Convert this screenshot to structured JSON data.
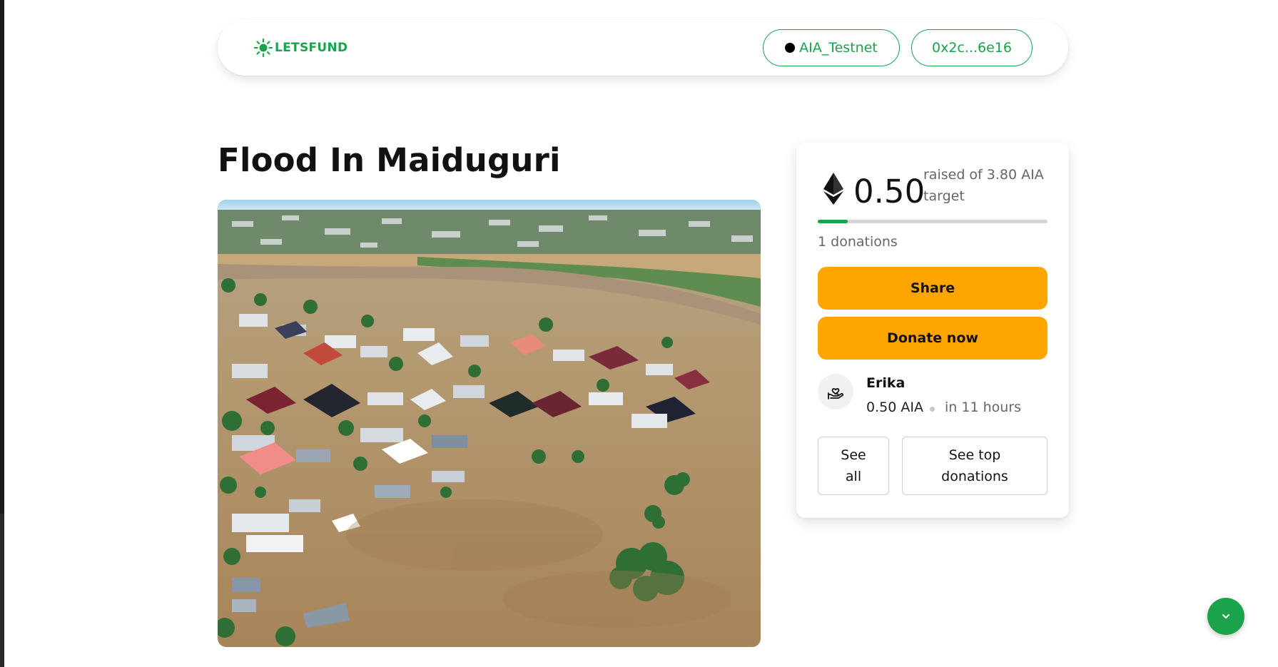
{
  "header": {
    "logo_text": "LETSFUND",
    "network_label": "AIA_Testnet",
    "wallet_address": "0x2c...6e16"
  },
  "campaign": {
    "title": "Flood In Maiduguri",
    "image_alt": "Flood In Maiduguri"
  },
  "funding": {
    "raised_amount": "0.50",
    "raised_caption": "raised of 3.80 AIA target",
    "progress_fraction": 0.13,
    "donations_count_text": "1 donations",
    "share_label": "Share",
    "donate_label": "Donate now"
  },
  "latest_donation": {
    "donor_name": "Erika",
    "amount": "0.50 AIA",
    "time": "in 11 hours"
  },
  "actions": {
    "see_all_label": "See all",
    "see_top_label": "See top donations"
  },
  "icons": {
    "logo": "sun-icon",
    "network_status": "dot-icon",
    "currency": "ethereum-icon",
    "donor": "hand-heart-icon",
    "scroll_down": "chevron-down-icon"
  },
  "colors": {
    "brand_green": "#1aa34a",
    "button_orange": "#ffa500",
    "progress_track": "#d4d4d8"
  }
}
